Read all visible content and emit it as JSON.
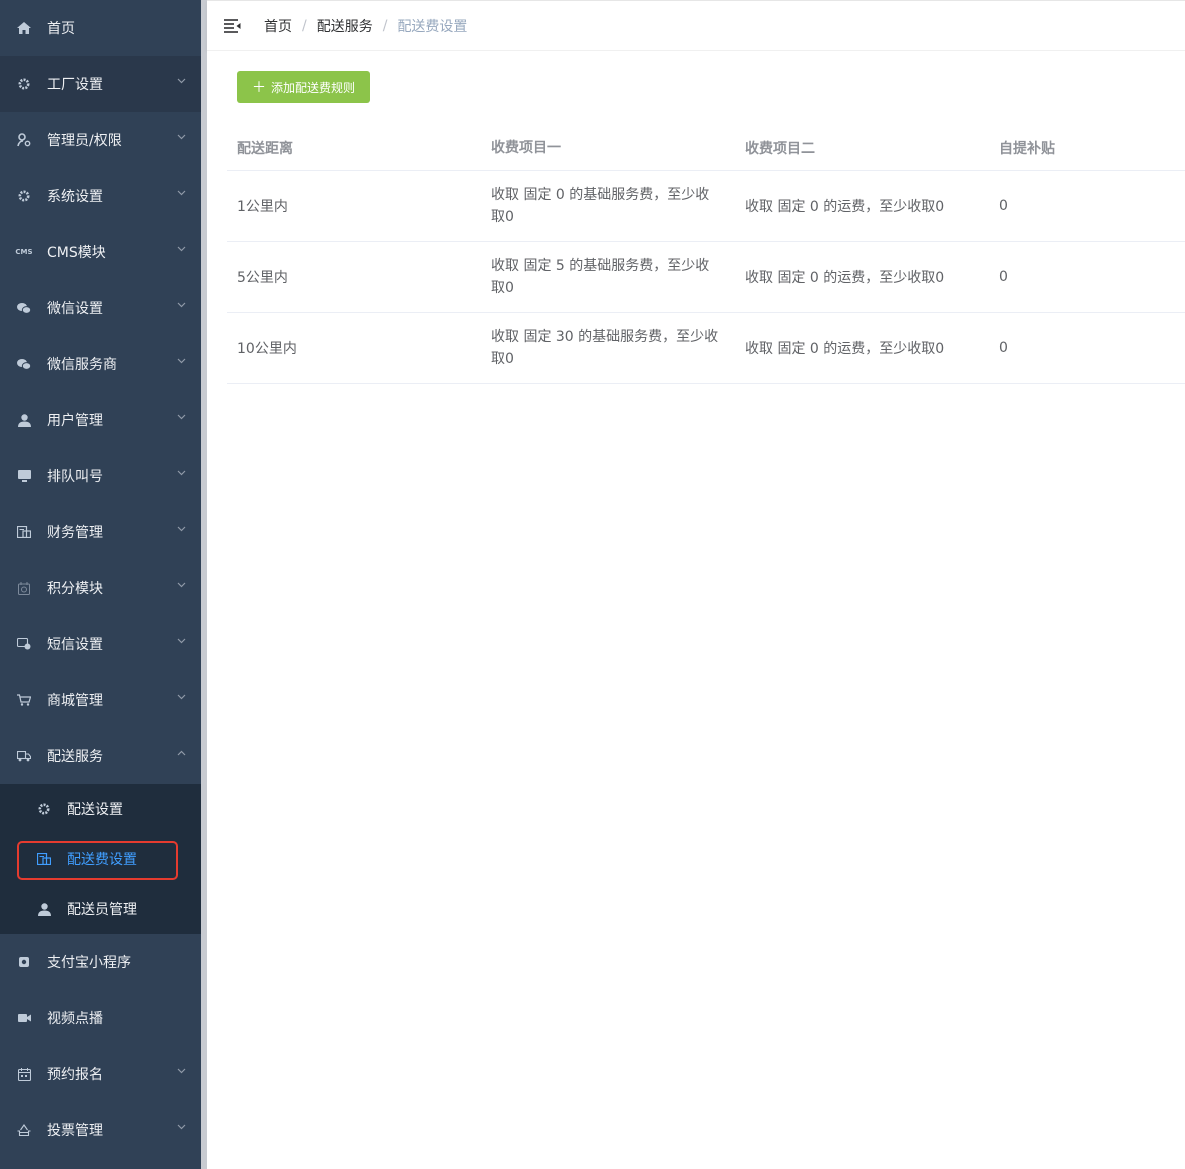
{
  "sidebar": {
    "items": [
      {
        "label": "首页",
        "icon": "home-icon",
        "chevron": false
      },
      {
        "label": "工厂设置",
        "icon": "gear-icon",
        "chevron": true,
        "selected": true
      },
      {
        "label": "管理员/权限",
        "icon": "user-key-icon",
        "chevron": true
      },
      {
        "label": "系统设置",
        "icon": "gear-icon",
        "chevron": true
      },
      {
        "label": "CMS模块",
        "icon": "cms-icon",
        "chevron": true
      },
      {
        "label": "微信设置",
        "icon": "wechat-icon",
        "chevron": true
      },
      {
        "label": "微信服务商",
        "icon": "wechat-icon",
        "chevron": true
      },
      {
        "label": "用户管理",
        "icon": "user-icon",
        "chevron": true
      },
      {
        "label": "排队叫号",
        "icon": "monitor-icon",
        "chevron": true
      },
      {
        "label": "财务管理",
        "icon": "finance-icon",
        "chevron": true
      },
      {
        "label": "积分模块",
        "icon": "points-icon",
        "chevron": true
      },
      {
        "label": "短信设置",
        "icon": "sms-icon",
        "chevron": true
      },
      {
        "label": "商城管理",
        "icon": "cart-icon",
        "chevron": true
      },
      {
        "label": "配送服务",
        "icon": "truck-icon",
        "chevron": true,
        "expanded": true
      }
    ],
    "submenu": [
      {
        "label": "配送设置",
        "icon": "gear-icon"
      },
      {
        "label": "配送费设置",
        "icon": "finance-icon",
        "active": true
      },
      {
        "label": "配送员管理",
        "icon": "user-icon"
      }
    ],
    "items_after": [
      {
        "label": "支付宝小程序",
        "icon": "alipay-icon",
        "chevron": false
      },
      {
        "label": "视频点播",
        "icon": "video-icon",
        "chevron": false
      },
      {
        "label": "预约报名",
        "icon": "calendar-icon",
        "chevron": true
      },
      {
        "label": "投票管理",
        "icon": "vote-icon",
        "chevron": true
      }
    ]
  },
  "header": {
    "breadcrumb": [
      "首页",
      "配送服务",
      "配送费设置"
    ],
    "separator": "/"
  },
  "main": {
    "add_button": "添加配送费规则",
    "table": {
      "columns": [
        "配送距离",
        "收费项目一",
        "收费项目二",
        "自提补贴"
      ],
      "rows": [
        [
          "1公里内",
          "收取 固定 0 的基础服务费，至少收取0",
          "收取 固定 0 的运费，至少收取0",
          "0"
        ],
        [
          "5公里内",
          "收取 固定 5 的基础服务费，至少收取0",
          "收取 固定 0 的运费，至少收取0",
          "0"
        ],
        [
          "10公里内",
          "收取 固定 30 的基础服务费，至少收取0",
          "收取 固定 0 的运费，至少收取0",
          "0"
        ]
      ]
    }
  },
  "colors": {
    "sidebar_bg": "#304156",
    "submenu_bg": "#1f2d3d",
    "active_text": "#409eff",
    "add_button_bg": "#8cc44a",
    "highlight_border": "#e53b2f"
  }
}
